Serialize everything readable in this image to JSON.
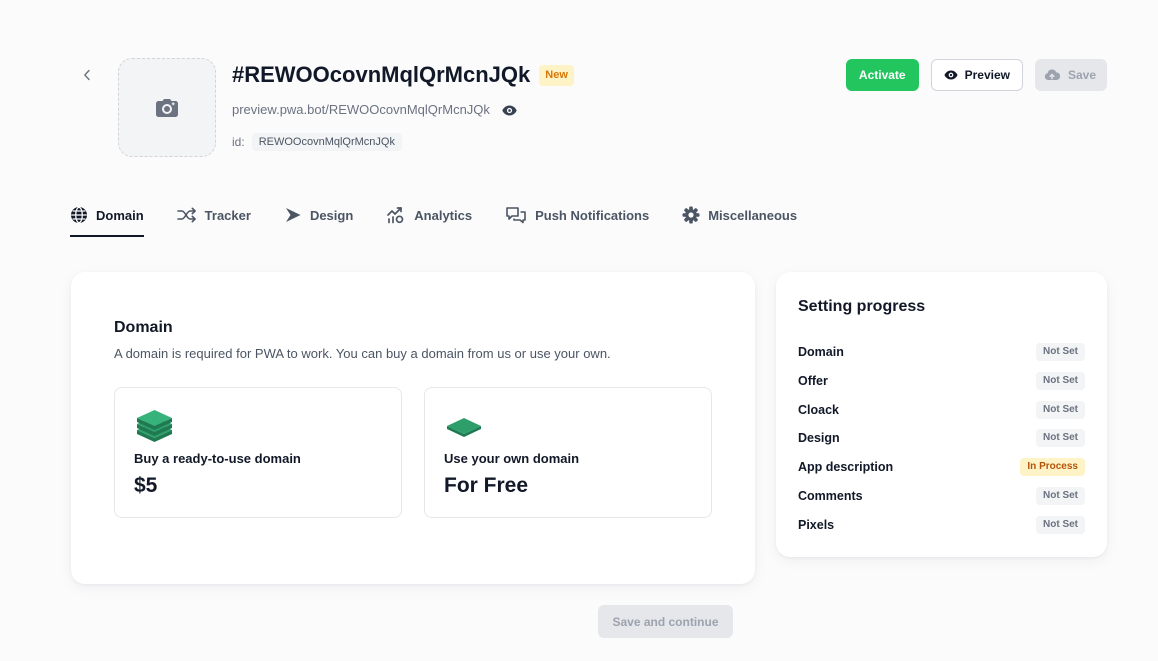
{
  "header": {
    "title": "#REWOOcovnMqlQrMcnJQk",
    "badge": "New",
    "preview_url": "preview.pwa.bot/REWOOcovnMqlQrMcnJQk",
    "id_label": "id:",
    "id_value": "REWOOcovnMqlQrMcnJQk",
    "back_icon": "chevron-left-icon",
    "avatar_icon": "camera-icon",
    "url_icon": "eye-icon"
  },
  "actions": {
    "activate": "Activate",
    "preview": "Preview",
    "preview_icon": "eye-icon",
    "save": "Save",
    "save_icon": "cloud-upload-icon",
    "save_disabled": true
  },
  "tabs": [
    {
      "label": "Domain",
      "icon": "globe-icon",
      "active": true
    },
    {
      "label": "Tracker",
      "icon": "shuffle-icon",
      "active": false
    },
    {
      "label": "Design",
      "icon": "play-icon",
      "active": false
    },
    {
      "label": "Analytics",
      "icon": "analytics-chart-icon",
      "active": false
    },
    {
      "label": "Push Notifications",
      "icon": "chat-bubbles-icon",
      "active": false
    },
    {
      "label": "Miscellaneous",
      "icon": "gear-icon",
      "active": false
    }
  ],
  "domain": {
    "title": "Domain",
    "description": "A domain is required for PWA to work. You can buy a domain from us or use your own.",
    "options": [
      {
        "label": "Buy a ready-to-use domain",
        "price": "$5",
        "icon": "layers-stack-icon"
      },
      {
        "label": "Use your own domain",
        "price": "For Free",
        "icon": "layer-icon"
      }
    ],
    "submit": "Save and continue",
    "submit_disabled": true
  },
  "progress": {
    "title": "Setting progress",
    "items": [
      {
        "label": "Domain",
        "status": "Not Set",
        "bg": "#f3f4f6",
        "fg": "#6b7280"
      },
      {
        "label": "Offer",
        "status": "Not Set",
        "bg": "#f3f4f6",
        "fg": "#6b7280"
      },
      {
        "label": "Cloack",
        "status": "Not Set",
        "bg": "#f3f4f6",
        "fg": "#6b7280"
      },
      {
        "label": "Design",
        "status": "Not Set",
        "bg": "#f3f4f6",
        "fg": "#6b7280"
      },
      {
        "label": "App description",
        "status": "In Process",
        "bg": "#fef3c7",
        "fg": "#b45309"
      },
      {
        "label": "Comments",
        "status": "Not Set",
        "bg": "#f3f4f6",
        "fg": "#6b7280"
      },
      {
        "label": "Pixels",
        "status": "Not Set",
        "bg": "#f3f4f6",
        "fg": "#6b7280"
      }
    ]
  },
  "colors": {
    "activate_bg": "#22c55e",
    "activate_fg": "#ffffff",
    "new_badge_bg": "#fef3c7",
    "new_badge_fg": "#d97706",
    "disabled_bg": "#e5e7eb",
    "disabled_fg": "#9ca3af"
  }
}
